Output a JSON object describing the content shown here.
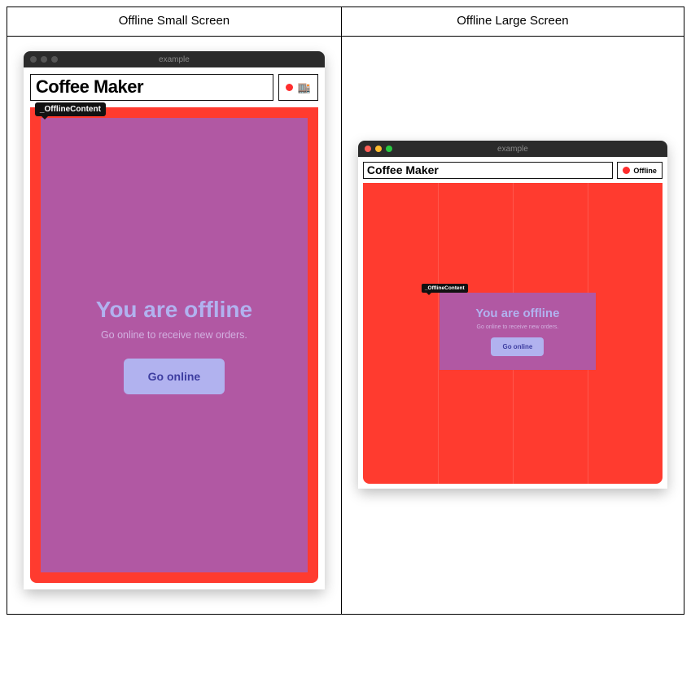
{
  "columns": {
    "small_title": "Offline Small Screen",
    "large_title": "Offline Large Screen"
  },
  "window": {
    "title": "example"
  },
  "header": {
    "brand": "Coffee Maker",
    "status_label": "Offline"
  },
  "annotation": {
    "label": "_OfflineContent"
  },
  "offline": {
    "heading": "You are offline",
    "subheading": "Go online to receive new orders.",
    "button_label": "Go online"
  },
  "icons": {
    "store_glyph": "🏬"
  },
  "colors": {
    "canvas_bg": "#ff3b2f",
    "overlay_bg": "#b158a3",
    "button_bg": "#b1b2ef",
    "status_dot": "#ff2d2d"
  }
}
